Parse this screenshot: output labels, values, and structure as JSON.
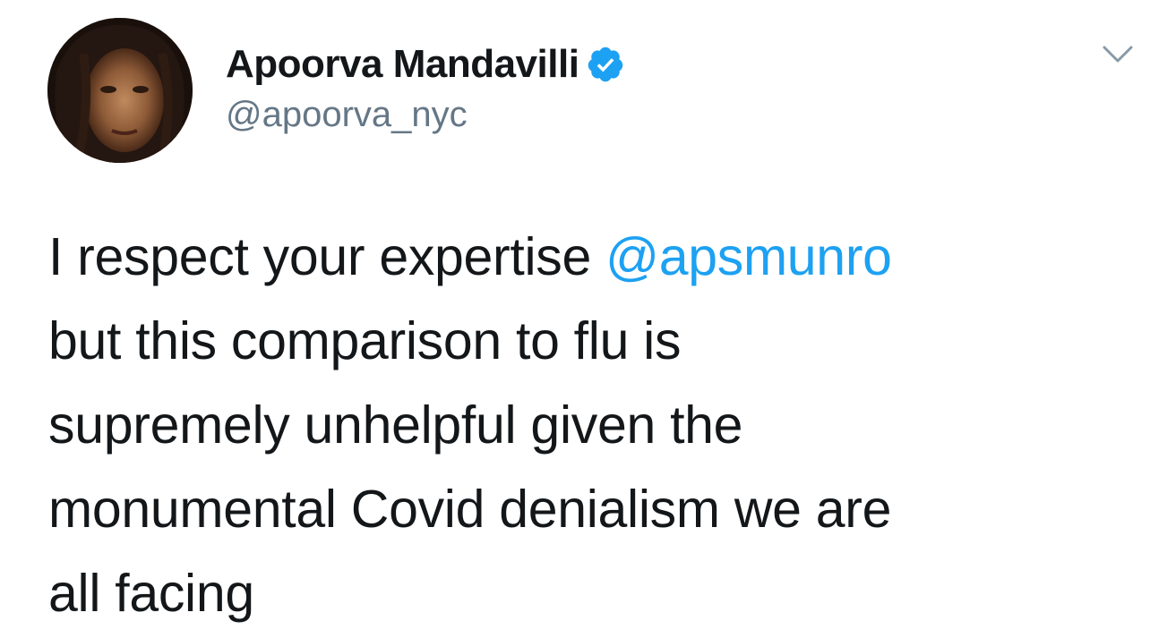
{
  "tweet": {
    "author": {
      "display_name": "Apoorva Mandavilli",
      "handle": "@apoorva_nyc",
      "verified": true,
      "avatar_icon": "profile-photo"
    },
    "menu_icon": "chevron-down-icon",
    "text_lines": [
      {
        "before": "I respect your expertise ",
        "mention": "@apsmunro"
      },
      {
        "text": "but this comparison to flu is"
      },
      {
        "text": "supremely unhelpful given the"
      },
      {
        "text": "monumental Covid denialism we are"
      },
      {
        "text": "all facing"
      }
    ]
  },
  "colors": {
    "mention": "#1da1f2",
    "verified_badge": "#1da1f2",
    "handle": "#657786",
    "text": "#14171a"
  }
}
